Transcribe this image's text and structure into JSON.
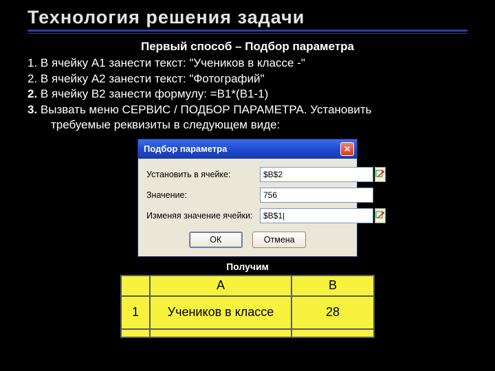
{
  "title": "Технология   решения  задачи",
  "subtitle": "Первый способ – Подбор параметра",
  "lines": {
    "l1": "1.   В ячейку А1 занести текст: \"Учеников в классе -\"",
    "l2": "2.   В ячейку А2 занести текст: \"Фотографий\"",
    "l3a": " 2. ",
    "l3b": "В ячейку В2 занести формулу:   =В1*(В1-1)",
    "l4a": " 3. ",
    "l4b": "Вызвать меню СЕРВИС / ПОДБОР ПАРАМЕТРА. Установить",
    "l5": "требуемые реквизиты в следующем виде:"
  },
  "dialog": {
    "title": "Подбор параметра",
    "row1_label": "Установить в ячейке:",
    "row1_value": "$B$2",
    "row2_label": "Значение:",
    "row2_value": "756",
    "row3_label": "Изменяя значение ячейки:",
    "row3_value": "$B$1|",
    "ok": "ОК",
    "cancel": "Отмена"
  },
  "result_label": "Получим",
  "table": {
    "hA": "A",
    "hB": "B",
    "r1n": "1",
    "r1a": "Учеников в классе",
    "r1b": "28",
    "r2n": ""
  }
}
